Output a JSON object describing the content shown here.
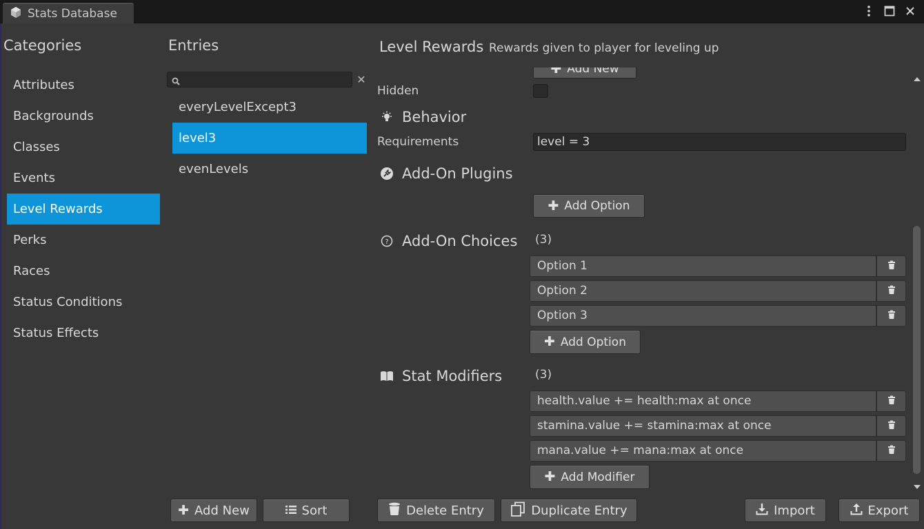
{
  "window": {
    "tab_title": "Stats Database"
  },
  "categories": {
    "header": "Categories",
    "items": [
      {
        "label": "Attributes"
      },
      {
        "label": "Backgrounds"
      },
      {
        "label": "Classes"
      },
      {
        "label": "Events"
      },
      {
        "label": "Level Rewards",
        "selected": true
      },
      {
        "label": "Perks"
      },
      {
        "label": "Races"
      },
      {
        "label": "Status Conditions"
      },
      {
        "label": "Status Effects"
      }
    ]
  },
  "entries": {
    "header": "Entries",
    "search_value": "",
    "items": [
      {
        "label": "everyLevelExcept3"
      },
      {
        "label": "level3",
        "selected": true
      },
      {
        "label": "evenLevels"
      }
    ]
  },
  "inspector": {
    "title": "Level Rewards",
    "description": "Rewards given to player for leveling up",
    "top_button": "Add New",
    "hidden_label": "Hidden",
    "hidden_checked": false,
    "behavior": {
      "title": "Behavior",
      "requirements_label": "Requirements",
      "requirements_value": "level = 3"
    },
    "plugins": {
      "title": "Add-On Plugins",
      "add_button": "Add Option"
    },
    "choices": {
      "title": "Add-On Choices",
      "count": "(3)",
      "items": [
        "Option 1",
        "Option 2",
        "Option 3"
      ],
      "add_button": "Add Option"
    },
    "modifiers": {
      "title": "Stat Modifiers",
      "count": "(3)",
      "items": [
        "health.value += health:max at once",
        "stamina.value += stamina:max at once",
        "mana.value += mana:max at once"
      ],
      "add_button": "Add Modifier"
    }
  },
  "bottom": {
    "add_new": "Add New",
    "sort": "Sort",
    "delete_entry": "Delete Entry",
    "duplicate_entry": "Duplicate Entry",
    "import": "Import",
    "export": "Export"
  },
  "colors": {
    "selection": "#0e95d9",
    "background": "#383838",
    "titlebar": "#191919"
  }
}
